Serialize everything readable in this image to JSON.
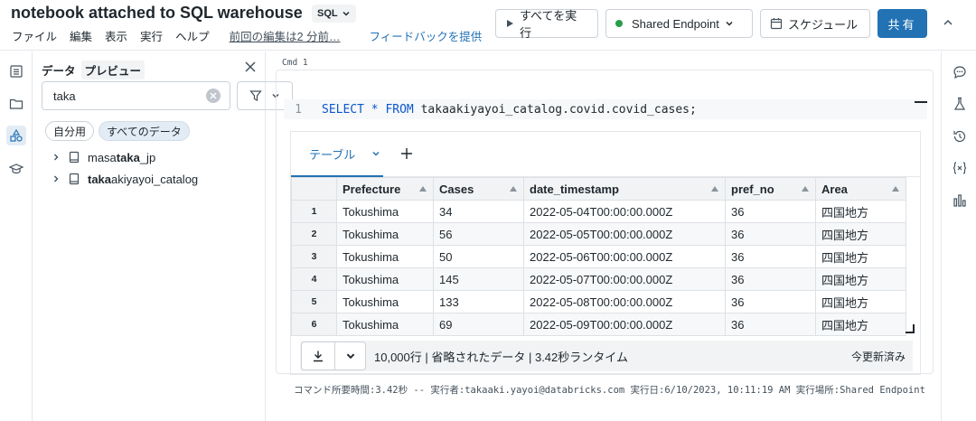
{
  "header": {
    "title": "notebook attached to SQL warehouse",
    "language": "SQL",
    "menu": [
      "ファイル",
      "編集",
      "表示",
      "実行",
      "ヘルプ"
    ],
    "last_edit": "前回の編集は2 分前…",
    "feedback": "フィードバックを提供",
    "run_all": "すべてを実行",
    "endpoint": "Shared Endpoint",
    "schedule": "スケジュール",
    "share": "共有"
  },
  "data_panel": {
    "title": "データ",
    "preview": "プレビュー",
    "search_value": "taka",
    "chips": [
      "自分用",
      "すべてのデータ"
    ],
    "tree": [
      {
        "pre": "masa",
        "match": "taka",
        "post": "_jp"
      },
      {
        "pre": "",
        "match": "taka",
        "post": "akiyayoi_catalog"
      }
    ]
  },
  "cell": {
    "cmd_label": "Cmd 1",
    "line_no": "1",
    "code_kw1": "SELECT",
    "code_star": " * ",
    "code_kw2": "FROM",
    "code_rest": " takaakiyayoi_catalog.covid.covid_cases;",
    "tab_label": "テーブル",
    "columns": [
      "Prefecture",
      "Cases",
      "date_timestamp",
      "pref_no",
      "Area"
    ],
    "rows": [
      [
        "1",
        "Tokushima",
        "34",
        "2022-05-04T00:00:00.000Z",
        "36",
        "四国地方"
      ],
      [
        "2",
        "Tokushima",
        "56",
        "2022-05-05T00:00:00.000Z",
        "36",
        "四国地方"
      ],
      [
        "3",
        "Tokushima",
        "50",
        "2022-05-06T00:00:00.000Z",
        "36",
        "四国地方"
      ],
      [
        "4",
        "Tokushima",
        "145",
        "2022-05-07T00:00:00.000Z",
        "36",
        "四国地方"
      ],
      [
        "5",
        "Tokushima",
        "133",
        "2022-05-08T00:00:00.000Z",
        "36",
        "四国地方"
      ],
      [
        "6",
        "Tokushima",
        "69",
        "2022-05-09T00:00:00.000Z",
        "36",
        "四国地方"
      ]
    ],
    "footer_info": "10,000行 | 省略されたデータ | 3.42秒ランタイム",
    "footer_updated": "今更新済み",
    "exec_meta": "コマンド所要時間:3.42秒 -- 実行者:takaaki.yayoi@databricks.com 実行日:6/10/2023, 10:11:19 AM 実行場所:Shared Endpoint"
  },
  "colors": {
    "accent": "#2272b4",
    "status_green": "#2a9d4a",
    "keyword": "#0b57d0"
  }
}
